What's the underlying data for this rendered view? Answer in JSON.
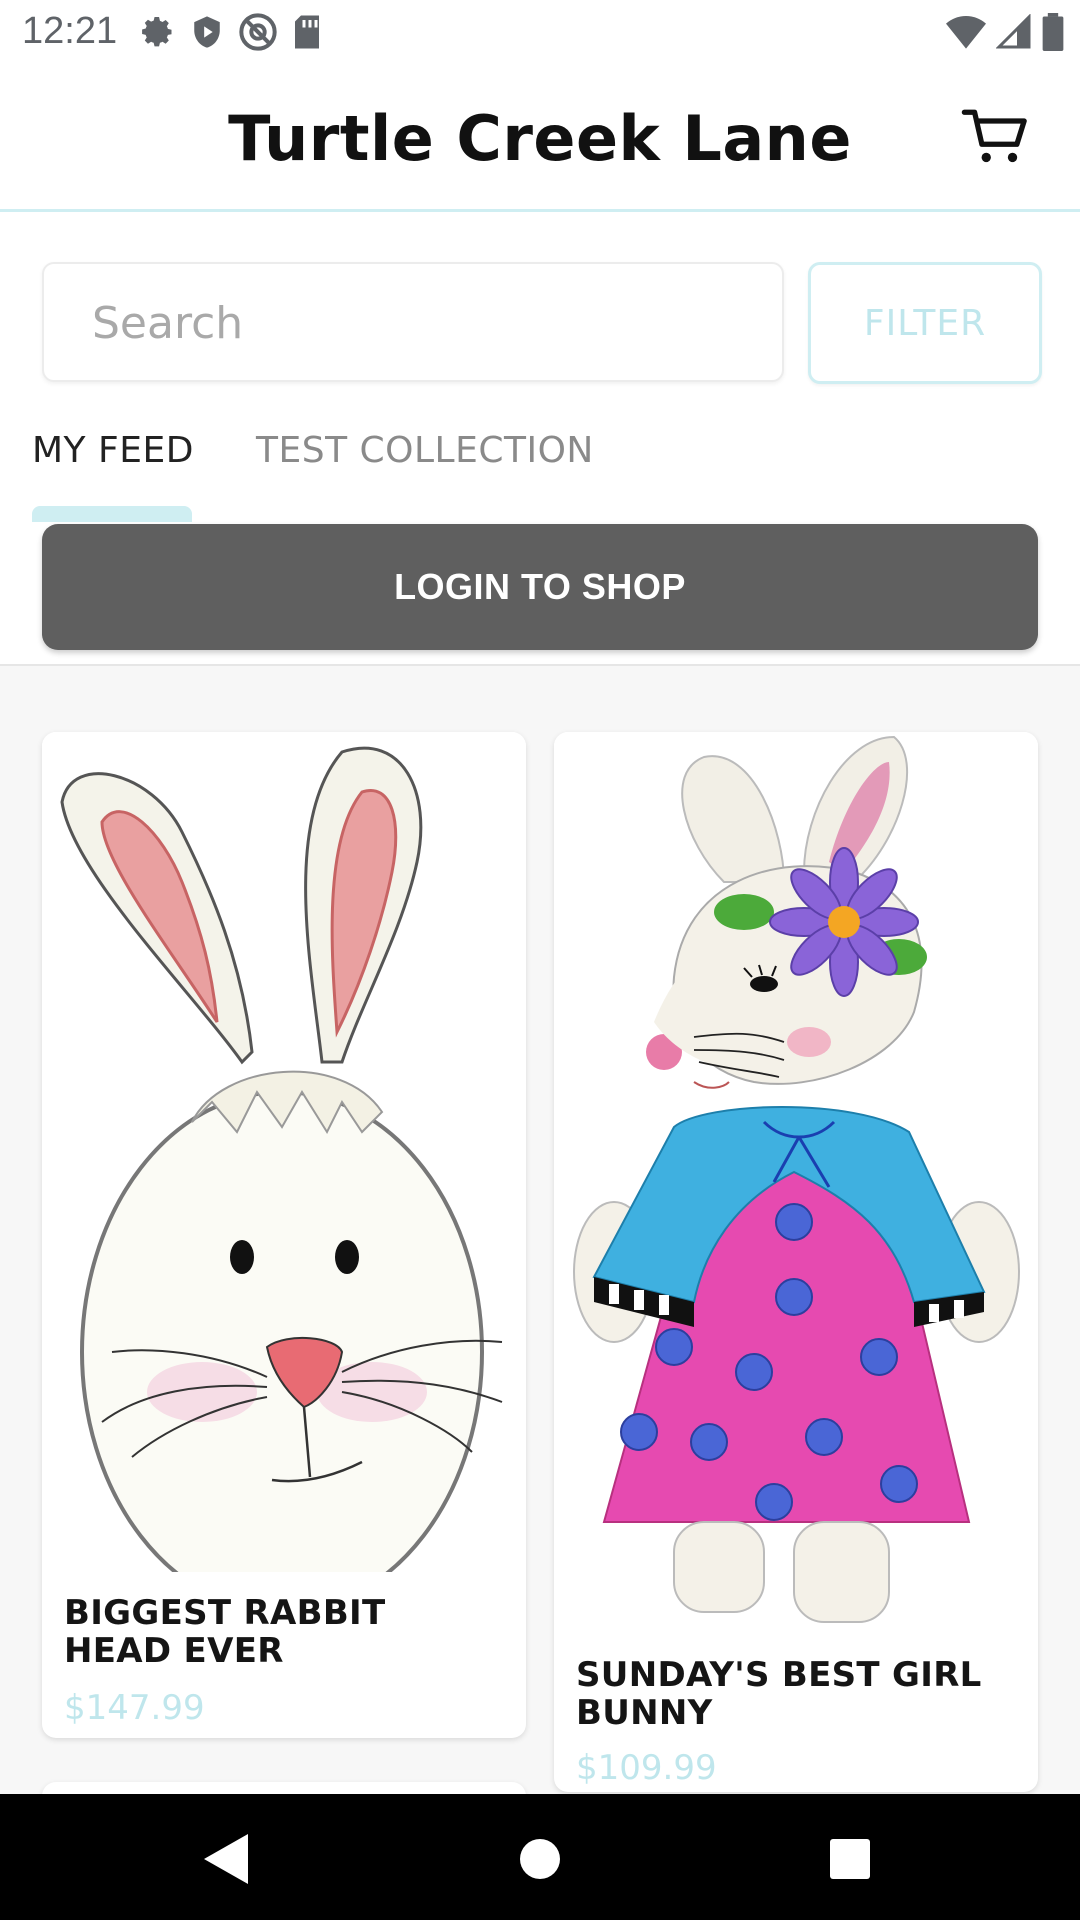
{
  "status": {
    "time": "12:21",
    "left_icons": [
      "gear-icon",
      "shield-play-icon",
      "at-sign-icon",
      "sd-card-icon"
    ],
    "right_icons": [
      "wifi-icon",
      "signal-icon",
      "battery-icon"
    ]
  },
  "header": {
    "title": "Turtle Creek Lane",
    "cart_icon": "cart-icon"
  },
  "search": {
    "placeholder": "Search",
    "value": ""
  },
  "filter": {
    "label": "FILTER"
  },
  "tabs": [
    {
      "label": "MY FEED",
      "selected": true
    },
    {
      "label": "TEST COLLECTION",
      "selected": false
    }
  ],
  "login": {
    "label": "LOGIN TO SHOP"
  },
  "products": [
    {
      "title": "BIGGEST RABBIT HEAD EVER",
      "price": "$147.99",
      "image": "rabbit-head-image"
    },
    {
      "title": "SUNDAY'S BEST GIRL BUNNY",
      "price": "$109.99",
      "image": "girl-bunny-image"
    }
  ],
  "nav": {
    "back_icon": "back-icon",
    "home_icon": "home-icon",
    "recents_icon": "recents-icon"
  },
  "colors": {
    "accent": "#cfeef2",
    "price": "#bfe6ec",
    "login_button": "#5f5f5f"
  }
}
